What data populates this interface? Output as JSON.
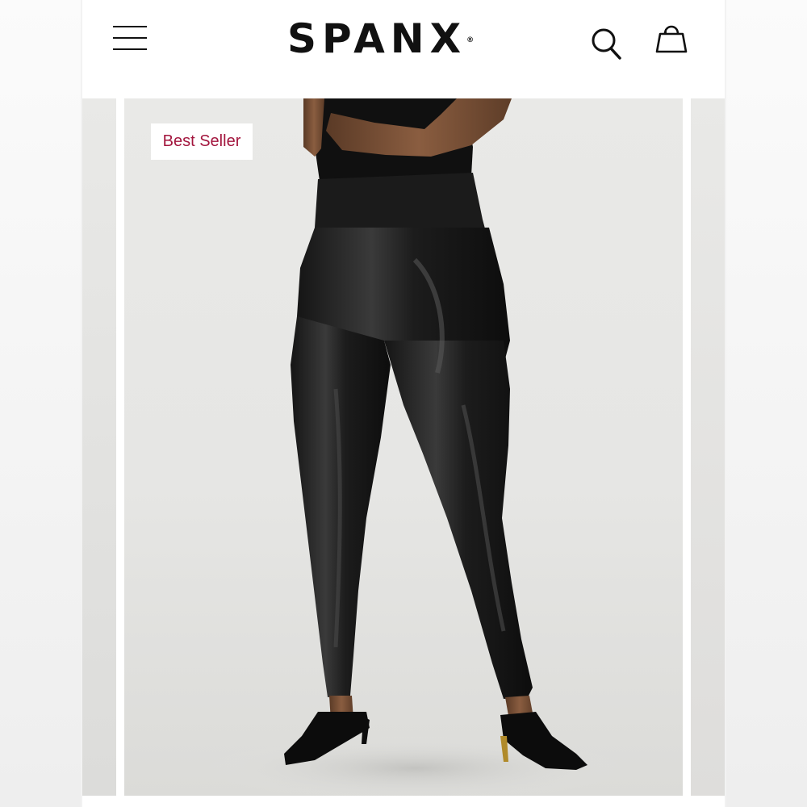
{
  "header": {
    "menu_icon": "hamburger-menu-icon",
    "logo_text": "SPANX",
    "logo_mark": "®",
    "search_icon": "search-icon",
    "bag_icon": "shopping-bag-icon"
  },
  "product_image": {
    "badge": "Best Seller"
  },
  "colors": {
    "badge_text": "#a3163e",
    "icon": "#111111"
  }
}
